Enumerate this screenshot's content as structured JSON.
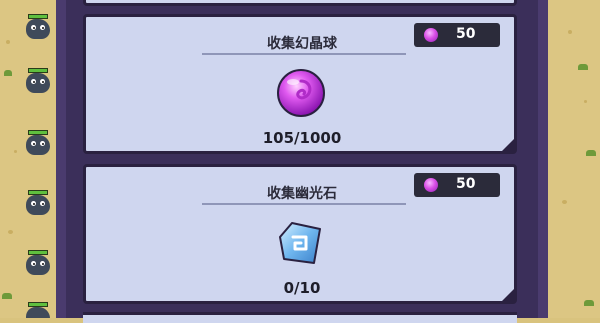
{
  "quests": [
    {
      "title": "收集幻晶球",
      "reward_amount": "50",
      "reward_icon": "purple-gem-icon",
      "progress": "105/1000",
      "item_icon": "crystal-orb-icon"
    },
    {
      "title": "收集幽光石",
      "reward_amount": "50",
      "reward_icon": "purple-gem-icon",
      "progress": "0/10",
      "item_icon": "glow-stone-icon"
    }
  ],
  "colors": {
    "panel": "#3b2f5a",
    "card": "#cfd6ef",
    "reward_bg": "#2b2b3a",
    "gem": "#d94fe6"
  }
}
